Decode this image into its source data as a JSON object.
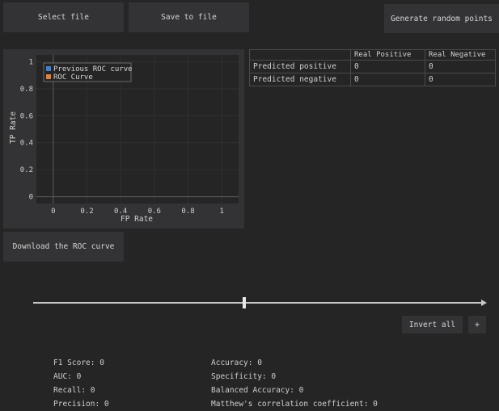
{
  "toolbar": {
    "select_file": "Select file",
    "save_to_file": "Save to file",
    "generate_random": "Generate random points",
    "download_roc": "Download the ROC curve"
  },
  "chart_data": {
    "type": "line",
    "xlabel": "FP Rate",
    "ylabel": "TP Rate",
    "x_ticks": [
      "0",
      "0.2",
      "0.4",
      "0.6",
      "0.8",
      "1"
    ],
    "y_ticks": [
      "0",
      "0.2",
      "0.4",
      "0.6",
      "0.8",
      "1"
    ],
    "xlim": [
      -0.1,
      1.1
    ],
    "ylim": [
      -0.05,
      1.05
    ],
    "grid": true,
    "legend_position": "top-left",
    "series": [
      {
        "name": "Previous ROC curve",
        "color": "#4a7fc4",
        "x": [],
        "y": []
      },
      {
        "name": "ROC Curve",
        "color": "#d9834c",
        "x": [],
        "y": []
      }
    ]
  },
  "confusion_matrix": {
    "headers": [
      "",
      "Real Positive",
      "Real Negative"
    ],
    "rows": [
      {
        "label": "Predicted positive",
        "values": [
          "0",
          "0"
        ]
      },
      {
        "label": "Predicted negative",
        "values": [
          "0",
          "0"
        ]
      }
    ]
  },
  "threshold_slider": {
    "value": 0.47
  },
  "actions": {
    "invert_all": "Invert all",
    "plus": "+"
  },
  "metrics": {
    "f1": "F1 Score: 0",
    "auc": "AUC: 0",
    "recall": "Recall: 0",
    "precision": "Precision: 0",
    "accuracy": "Accuracy: 0",
    "specificity": "Specificity: 0",
    "balanced_accuracy": "Balanced Accuracy: 0",
    "matthews": "Matthew's correlation coefficient: 0"
  }
}
